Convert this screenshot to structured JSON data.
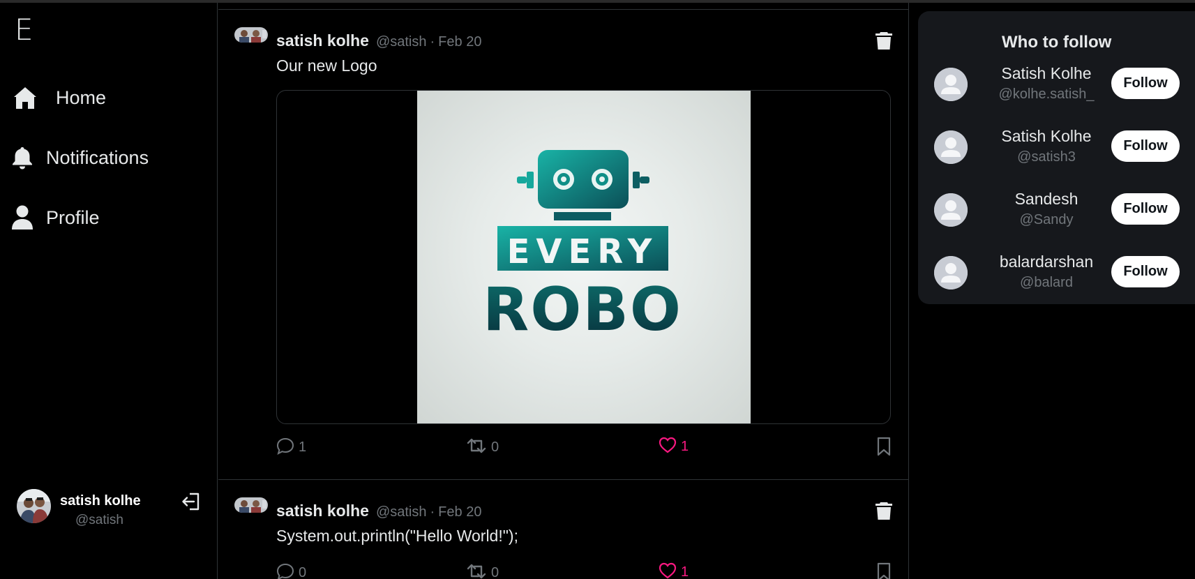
{
  "app": {
    "logo_letter": "E"
  },
  "nav": [
    {
      "label": "Home",
      "icon": "home-icon"
    },
    {
      "label": "Notifications",
      "icon": "bell-icon"
    },
    {
      "label": "Profile",
      "icon": "user-icon"
    }
  ],
  "current_user": {
    "name": "satish kolhe",
    "handle": "@satish"
  },
  "posts": [
    {
      "author": "satish kolhe",
      "handle": "@satish",
      "separator": "·",
      "date": "Feb 20",
      "text": "Our new Logo",
      "image": {
        "brand_top": "EVERY",
        "brand_bottom": "ROBO"
      },
      "replies": "1",
      "retweets": "0",
      "likes": "1"
    },
    {
      "author": "satish kolhe",
      "handle": "@satish",
      "separator": "·",
      "date": "Feb 20",
      "text": "System.out.println(\"Hello World!\");",
      "replies": "0",
      "retweets": "0",
      "likes": "1"
    }
  ],
  "who_to_follow": {
    "title": "Who to follow",
    "users": [
      {
        "name": "Satish Kolhe",
        "handle": "@kolhe.satish_",
        "button": "Follow"
      },
      {
        "name": "Satish Kolhe",
        "handle": "@satish3",
        "button": "Follow"
      },
      {
        "name": "Sandesh",
        "handle": "@Sandy",
        "button": "Follow"
      },
      {
        "name": "balardarshan",
        "handle": "@balard",
        "button": "Follow"
      }
    ]
  },
  "colors": {
    "background": "#000000",
    "panel": "#16181c",
    "muted_text": "#71767b",
    "like_pink": "#f91880",
    "robot_teal": "#0e9a90"
  }
}
